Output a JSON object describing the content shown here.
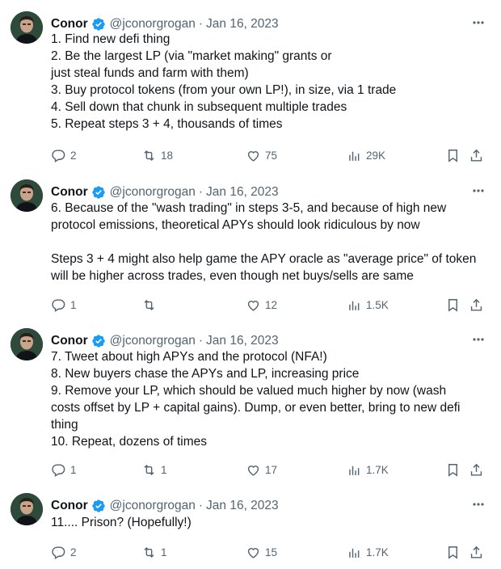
{
  "tweets": [
    {
      "name": "Conor",
      "handle": "@jconorgrogan",
      "separator": "·",
      "date": "Jan 16, 2023",
      "lines": [
        "1. Find new defi thing",
        "2. Be the largest LP (via \"market making\" grants or",
        "just steal funds and farm with them)",
        "3. Buy protocol tokens (from your own LP!), in size, via 1 trade",
        "4. Sell down that chunk in subsequent multiple trades",
        "5. Repeat steps 3 + 4, thousands of times"
      ],
      "replies": "2",
      "retweets": "18",
      "likes": "75",
      "views": "29K"
    },
    {
      "name": "Conor",
      "handle": "@jconorgrogan",
      "separator": "·",
      "date": "Jan 16, 2023",
      "lines": [
        "6. Because of the \"wash trading\" in steps 3-5, and because of high new",
        "protocol emissions, theoretical APYs should look ridiculous by now",
        "",
        "Steps 3 + 4 might also help game the APY oracle as \"average price\" of token",
        "will be higher across trades, even though net buys/sells are same"
      ],
      "replies": "1",
      "retweets": "",
      "likes": "12",
      "views": "1.5K"
    },
    {
      "name": "Conor",
      "handle": "@jconorgrogan",
      "separator": "·",
      "date": "Jan 16, 2023",
      "lines": [
        "7. Tweet about high APYs and the protocol (NFA!)",
        "8. New buyers chase the APYs and LP, increasing price",
        "9. Remove your LP, which should be valued much higher by now (wash",
        "costs offset by LP + capital gains). Dump, or even better, bring to new defi",
        "thing",
        "10. Repeat, dozens of times"
      ],
      "replies": "1",
      "retweets": "1",
      "likes": "17",
      "views": "1.7K"
    },
    {
      "name": "Conor",
      "handle": "@jconorgrogan",
      "separator": "·",
      "date": "Jan 16, 2023",
      "lines": [
        "11.... Prison? (Hopefully!)"
      ],
      "replies": "2",
      "retweets": "1",
      "likes": "15",
      "views": "1.7K"
    }
  ],
  "colors": {
    "text": "#0f1419",
    "secondary": "#536471",
    "verified": "#1d9bf0"
  },
  "icons": [
    "verified-badge-icon",
    "more-icon",
    "reply-icon",
    "retweet-icon",
    "like-icon",
    "views-icon",
    "bookmark-icon",
    "share-icon"
  ]
}
